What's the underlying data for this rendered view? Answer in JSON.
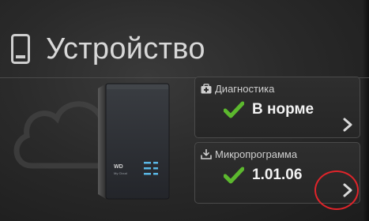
{
  "header": {
    "title": "Устройство",
    "icon": "device-icon"
  },
  "device": {
    "image": "nas-device-image",
    "logo_text": "WD",
    "model_text": "My Cloud"
  },
  "cards": [
    {
      "icon": "medkit-icon",
      "label": "Диагностика",
      "status_icon": "check-icon",
      "value": "В норме",
      "action_icon": "chevron-right-icon"
    },
    {
      "icon": "download-icon",
      "label": "Микропрограмма",
      "status_icon": "check-icon",
      "value": "1.01.06",
      "action_icon": "chevron-right-icon"
    }
  ],
  "colors": {
    "accent_green": "#5cb82e",
    "annotation_red": "#e0242a",
    "text": "#e6e6e6"
  }
}
